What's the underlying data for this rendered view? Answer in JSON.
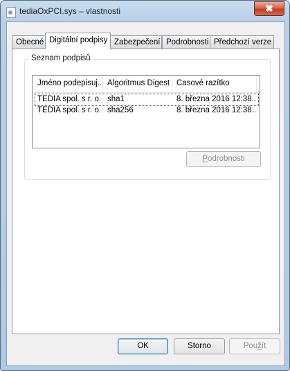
{
  "window": {
    "title": "tediaOxPCI.sys – vlastnosti",
    "close_label": "✖"
  },
  "tabs": [
    {
      "label": "Obecné"
    },
    {
      "label": "Digitální podpisy"
    },
    {
      "label": "Zabezpečení"
    },
    {
      "label": "Podrobnosti"
    },
    {
      "label": "Předchozí verze"
    }
  ],
  "active_tab": "Digitální podpisy",
  "signatures": {
    "group_label": "Seznam podpisů",
    "columns": [
      "Jméno podepisuj...",
      "Algoritmus Digest",
      "Časové razítko"
    ],
    "rows": [
      {
        "name": "TEDIA spol. s r. o.",
        "digest": "sha1",
        "timestamp": "8. března 2016 12:38..."
      },
      {
        "name": "TEDIA spol. s r. o.",
        "digest": "sha256",
        "timestamp": "8. března 2016 12:38..."
      }
    ],
    "details_button": {
      "accel": "P",
      "rest": "odrobnosti"
    }
  },
  "footer": {
    "ok_label": "OK",
    "cancel_label": "Storno",
    "apply_label": {
      "pre": "Pou",
      "accel": "ž",
      "post": "ít"
    }
  }
}
